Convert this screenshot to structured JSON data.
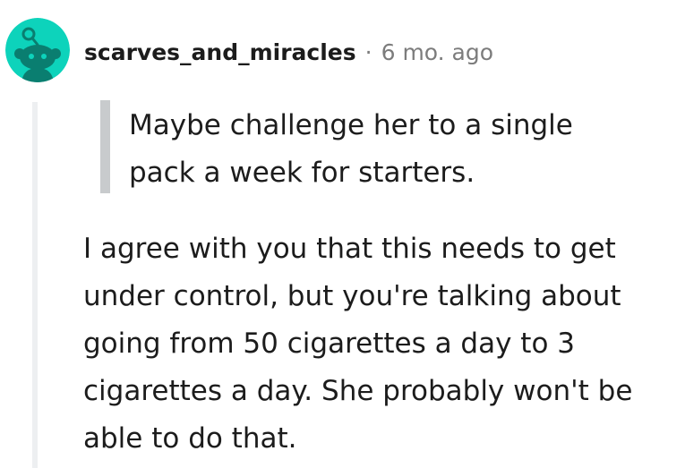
{
  "comment": {
    "author": "scarves_and_miracles",
    "separator": "·",
    "timestamp": "6 mo. ago",
    "avatar_icon": "snoo-avatar-icon",
    "avatar_color": "#0dd3bb",
    "quote_lines": [
      "Maybe challenge her to a single",
      "pack a week for starters."
    ],
    "body_lines": [
      "I agree with you that this needs to get",
      "under control, but you're talking about",
      "going from 50 cigarettes a day to 3",
      "cigarettes a day. She probably won't be",
      "able to do that."
    ]
  }
}
